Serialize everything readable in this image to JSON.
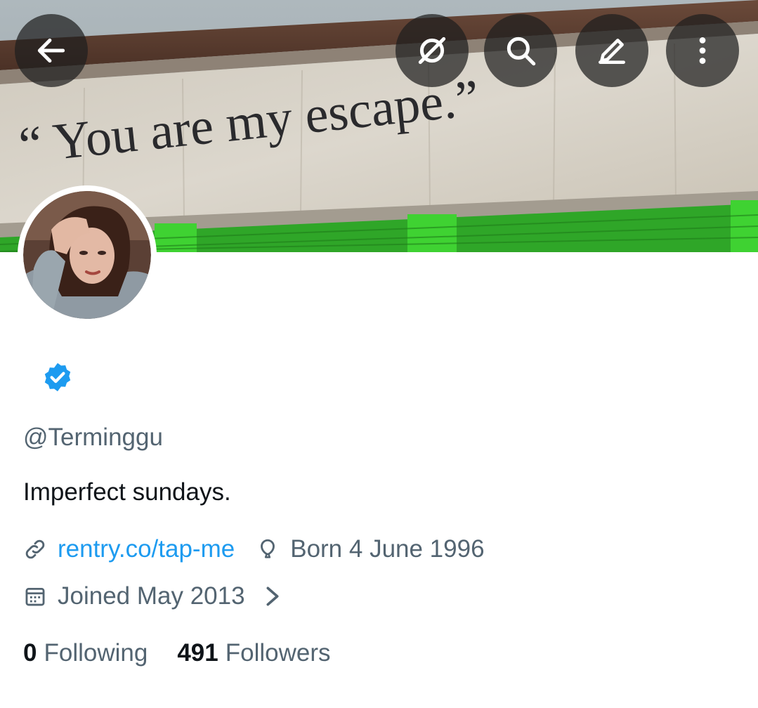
{
  "banner": {
    "quote_text": "“ You are my escape.”",
    "wall_color": "#d9d4ca",
    "accent_green": "#3fd232"
  },
  "top_bar": {
    "back_icon": "arrow-left-icon",
    "grok_icon": "slashed-circle-icon",
    "search_icon": "search-icon",
    "edit_icon": "edit-pencil-icon",
    "more_icon": "more-vertical-icon"
  },
  "profile": {
    "verified": true,
    "verified_color": "#1d9bf0",
    "handle": "@Terminggu",
    "bio": "Imperfect sundays.",
    "link": "rentry.co/tap-me",
    "birthday": "Born 4 June 1996",
    "joined": "Joined May 2013"
  },
  "stats": {
    "following_count": "0",
    "following_label": "Following",
    "followers_count": "491",
    "followers_label": "Followers"
  }
}
